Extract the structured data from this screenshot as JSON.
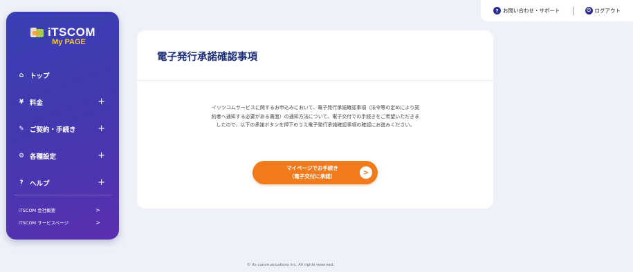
{
  "logo": {
    "brand": "iTSCOM",
    "sub": "My PAGE"
  },
  "nav": {
    "items": [
      {
        "icon": "⌂",
        "label": "トップ",
        "expand": ""
      },
      {
        "icon": "¥",
        "label": "料金",
        "expand": "+"
      },
      {
        "icon": "✎",
        "label": "ご契約・手続き",
        "expand": "+"
      },
      {
        "icon": "⚙",
        "label": "各種設定",
        "expand": "+"
      },
      {
        "icon": "?",
        "label": "ヘルプ",
        "expand": "+"
      }
    ]
  },
  "sublinks": [
    {
      "label": "iTSCOM 会社概要",
      "arrow": ">"
    },
    {
      "label": "iTSCOM サービスページ",
      "arrow": ">"
    }
  ],
  "topbar": {
    "contact_icon": "?",
    "contact_label": "お問い合わせ・サポート",
    "logout_icon": "⏻",
    "logout_label": "ログアウト"
  },
  "main": {
    "title": "電子発行承諾確認事項",
    "text_lines": [
      "イッツコムサービスに関するお申込みにおいて、電子発行承諾確認事項（法令等の定めにより契",
      "約者へ通知する必要がある書面）の通知方法について、電子交付での手続きをご希望いただきま",
      "したので、以下の承諾ボタンを押下のうえ電子発行承諾確認事項の確認にお進みください。"
    ],
    "cta_line1": "マイページでお手続き",
    "cta_line2": "（電子交付に承諾）",
    "cta_arrow": ">"
  },
  "footer": "© its communications Inc. All rights reserved."
}
